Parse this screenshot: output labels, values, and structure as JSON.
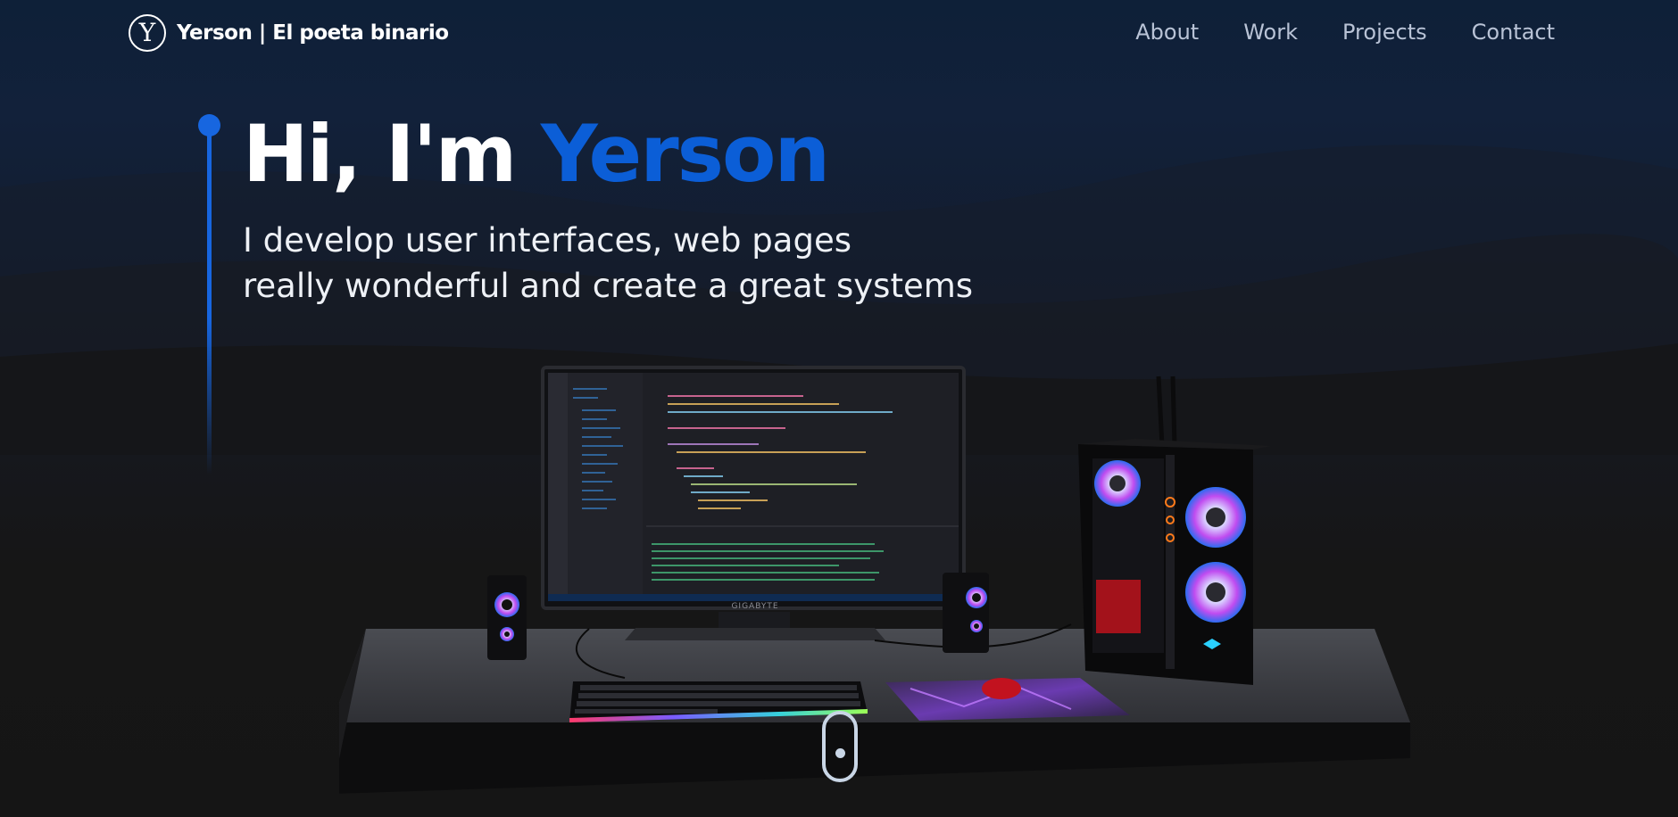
{
  "navbar": {
    "logo_letter": "Y",
    "brand": "Yerson | El poeta binario",
    "links": [
      "About",
      "Work",
      "Projects",
      "Contact"
    ]
  },
  "hero": {
    "title_prefix": "Hi, I'm ",
    "title_highlight": "Yerson",
    "subtitle_line1": "I develop user interfaces, web pages",
    "subtitle_line2": "really wonderful and create a great systems"
  },
  "scene": {
    "monitor_brand": "GIGABYTE"
  },
  "colors": {
    "accent": "#0b5ed7",
    "background_top": "#0e2038",
    "background_bottom": "#151515",
    "nav_text": "#b9c3d6"
  },
  "icons": [
    "logo-y-icon",
    "mouse-scroll-icon"
  ]
}
